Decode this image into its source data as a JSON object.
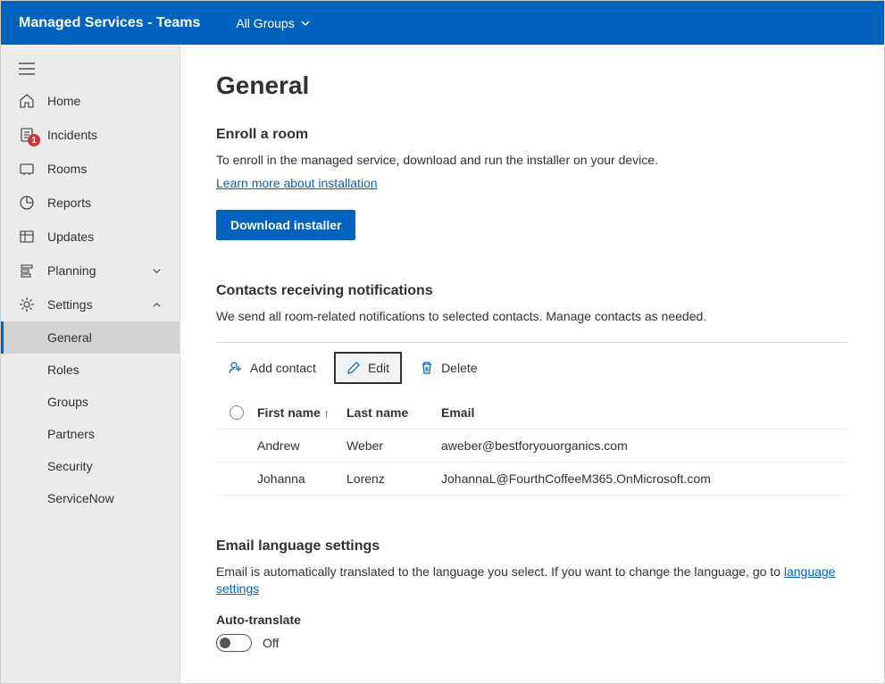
{
  "topbar": {
    "title": "Managed Services - Teams",
    "dropdown_label": "All Groups"
  },
  "sidebar": {
    "items": [
      {
        "label": "Home"
      },
      {
        "label": "Incidents",
        "badge": "1"
      },
      {
        "label": "Rooms"
      },
      {
        "label": "Reports"
      },
      {
        "label": "Updates"
      },
      {
        "label": "Planning"
      },
      {
        "label": "Settings"
      }
    ],
    "settings_sub": [
      {
        "label": "General"
      },
      {
        "label": "Roles"
      },
      {
        "label": "Groups"
      },
      {
        "label": "Partners"
      },
      {
        "label": "Security"
      },
      {
        "label": "ServiceNow"
      }
    ]
  },
  "page": {
    "title": "General",
    "enroll": {
      "heading": "Enroll a room",
      "desc": "To enroll in the managed service, download and run the installer on your device.",
      "link": "Learn more about installation",
      "button": "Download installer"
    },
    "contacts": {
      "heading": "Contacts receiving notifications",
      "desc": "We send all room-related notifications to selected contacts. Manage contacts as needed.",
      "actions": {
        "add": "Add contact",
        "edit": "Edit",
        "delete": "Delete"
      },
      "columns": {
        "first": "First name",
        "last": "Last name",
        "email": "Email"
      },
      "rows": [
        {
          "first": "Andrew",
          "last": "Weber",
          "email": "aweber@bestforyouorganics.com"
        },
        {
          "first": "Johanna",
          "last": "Lorenz",
          "email": "JohannaL@FourthCoffeeM365.OnMicrosoft.com"
        }
      ]
    },
    "language": {
      "heading": "Email language settings",
      "desc_pre": "Email is automatically translated to the language you select. If you want to change the language, go to ",
      "link": "language settings",
      "toggle_label": "Auto-translate",
      "toggle_state": "Off"
    }
  }
}
